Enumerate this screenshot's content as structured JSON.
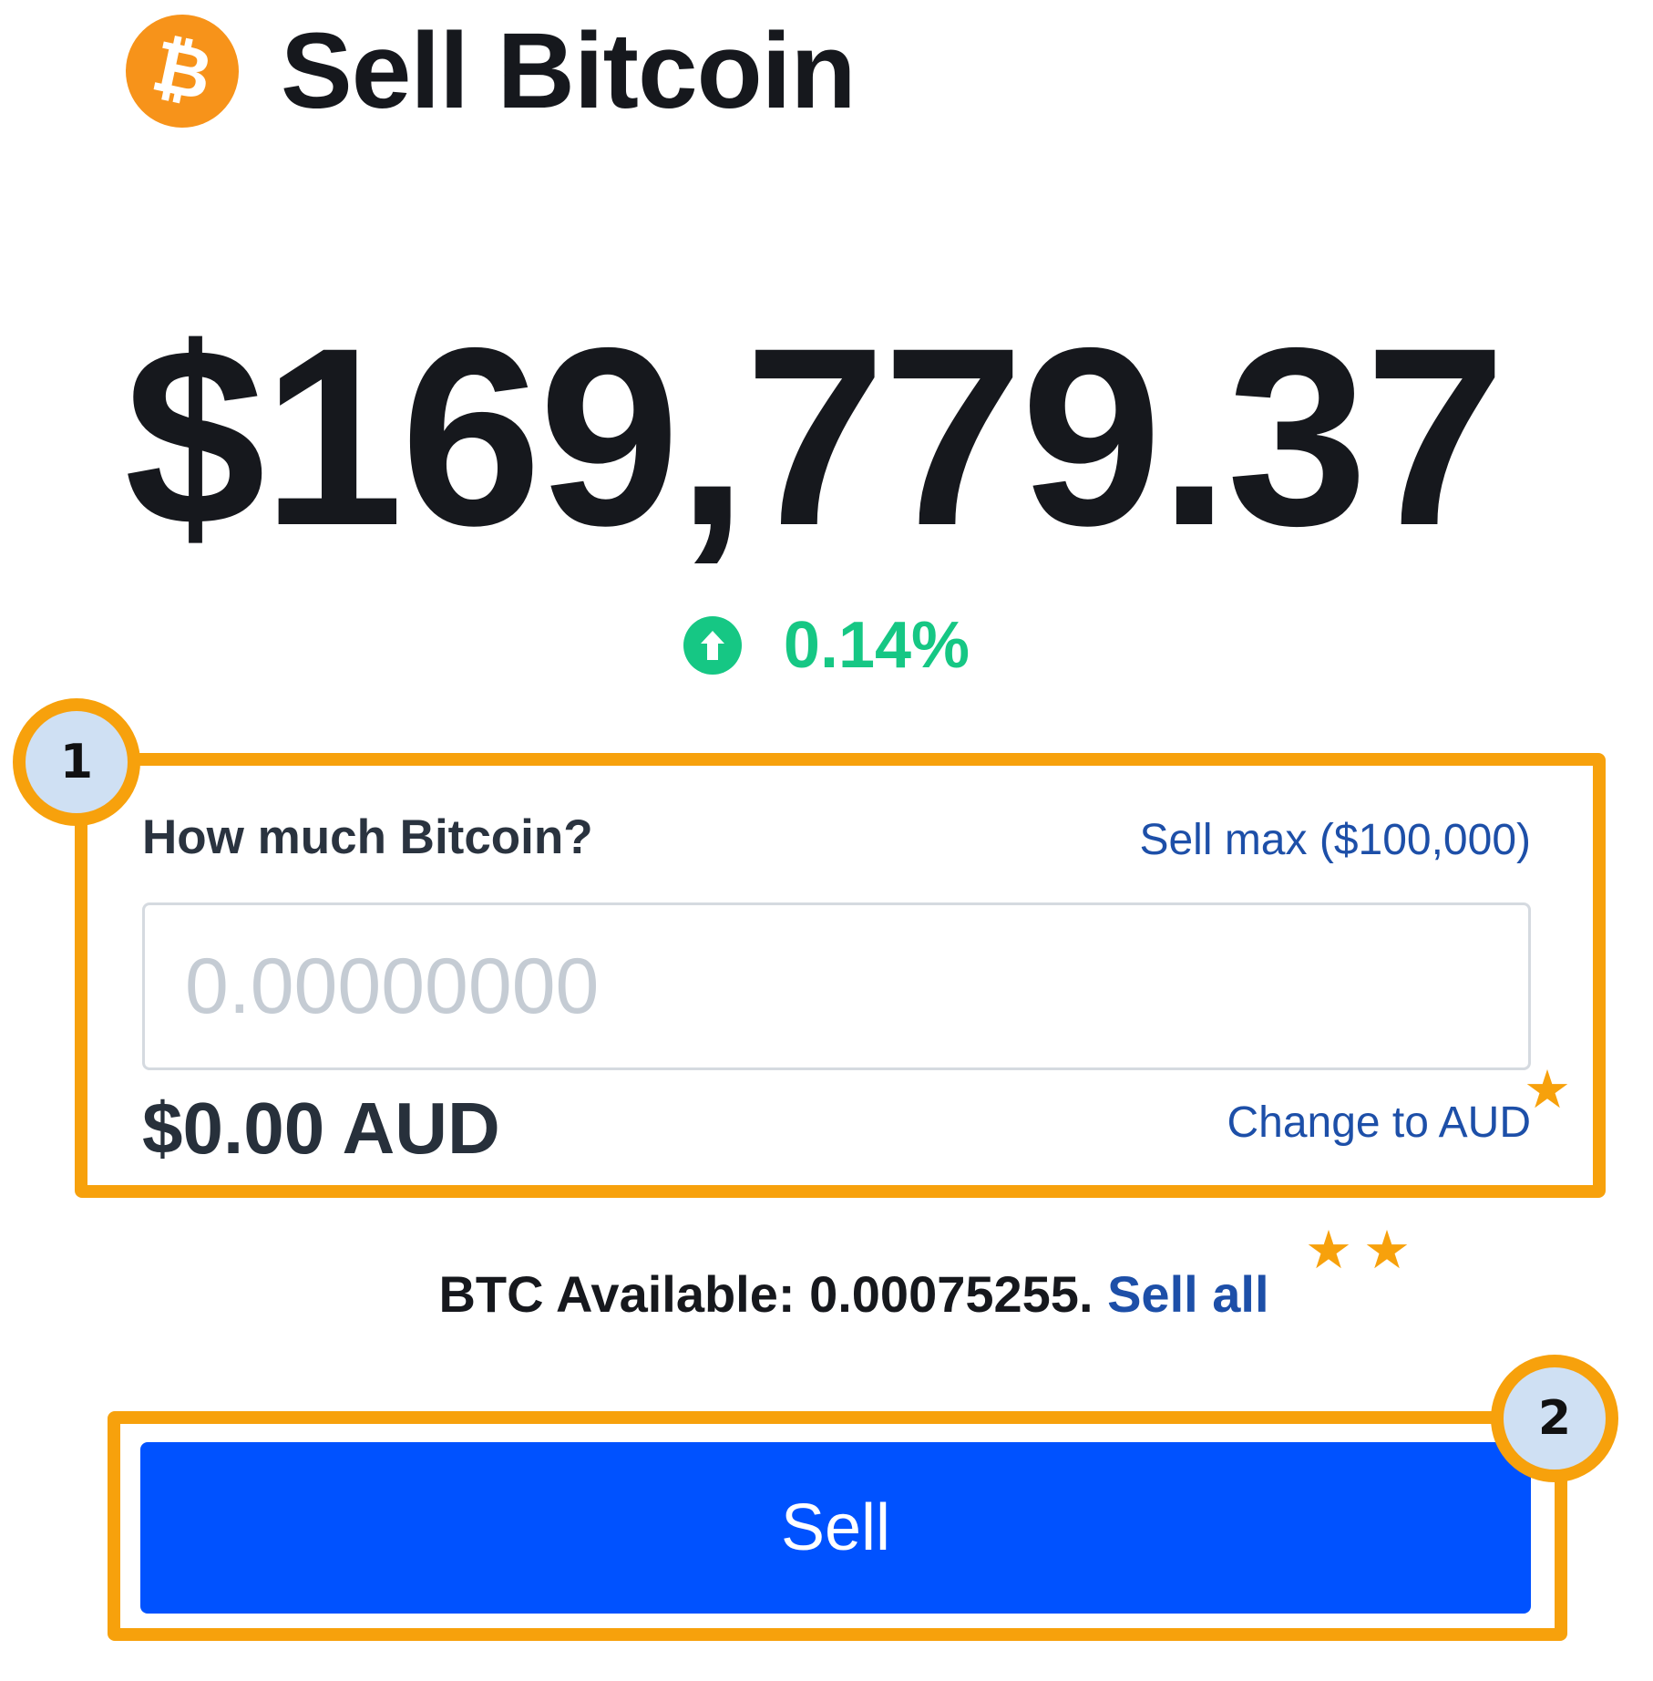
{
  "header": {
    "logo_glyph": "₿",
    "title": "Sell Bitcoin"
  },
  "price": {
    "value": "$169,779.37",
    "change": "0.14%",
    "change_direction_icon": "up-arrow-icon",
    "change_color": "#16c784"
  },
  "form": {
    "label": "How much Bitcoin?",
    "sell_max_link": "Sell max ($100,000)",
    "amount_input": {
      "value": "",
      "placeholder": "0.00000000"
    },
    "fiat_value": "$0.00 AUD",
    "change_currency_link": "Change to AUD"
  },
  "available": {
    "text": "BTC Available: 0.00075255.",
    "sell_all_link": "Sell all"
  },
  "sell_button": {
    "label": "Sell",
    "color": "#0052ff"
  },
  "annotations": {
    "badge_1": "1",
    "badge_2": "2",
    "star_1": "★",
    "star_2": "★",
    "star_3": "★",
    "highlight_color": "#f7a10c"
  },
  "colors": {
    "brand_orange": "#f7931a",
    "link_blue": "#1d4fa8"
  }
}
